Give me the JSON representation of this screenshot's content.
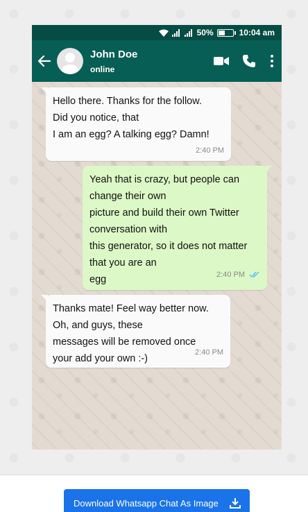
{
  "status_bar": {
    "battery_percent": "50%",
    "time": "10:04 am"
  },
  "header": {
    "name": "John Doe",
    "status": "online"
  },
  "messages": [
    {
      "direction": "incoming",
      "lines": [
        "Hello there. Thanks for the follow.",
        "Did you notice, that",
        "I am an egg? A talking egg? Damn!"
      ],
      "time": "2:40 PM"
    },
    {
      "direction": "outgoing",
      "lines": [
        "Yeah that is crazy, but people can",
        "change their own",
        "picture and build their own Twitter",
        "conversation with",
        "this generator, so it does not matter",
        "that you are an",
        "egg"
      ],
      "time": "2:40 PM",
      "read": true
    },
    {
      "direction": "incoming",
      "lines": [
        "Thanks mate! Feel way better now.",
        "Oh, and guys, these",
        "messages will be removed once",
        "your add your own :-)"
      ],
      "time": "2:40 PM"
    }
  ],
  "footer": {
    "download_label": "Download Whatsapp Chat As Image"
  },
  "colors": {
    "header": "#075e54",
    "status_bar": "#054c44",
    "outgoing_bubble": "#dcf8c6",
    "read_ticks": "#4fc3f7",
    "download_button": "#1a73e8"
  }
}
